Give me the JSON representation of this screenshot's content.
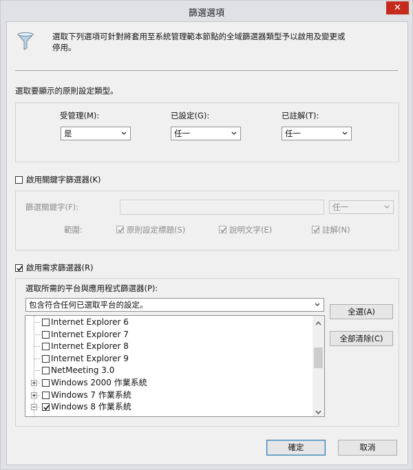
{
  "window": {
    "title": "篩選選項",
    "close_glyph": "✕"
  },
  "intro": {
    "text_line1": "選取下列選項可針對將套用至系統管理範本節點的全域篩選器類型予以啟用及變更或",
    "text_line2": "停用。"
  },
  "type_section": {
    "label": "選取要顯示的原則設定類型。"
  },
  "managed": {
    "label": "受管理(M):",
    "value": "是"
  },
  "configured": {
    "label": "已設定(G):",
    "value": "任一"
  },
  "commented": {
    "label": "已註解(T):",
    "value": "任一"
  },
  "keyword": {
    "checkbox_label": "啟用關鍵字篩選器(K)",
    "checked": false,
    "filter_label": "篩選關鍵字(F):",
    "input_value": "",
    "match_value": "任一",
    "scope_label": "範圍:",
    "scope_policy_title": "原則設定標題(S)",
    "scope_help_text": "說明文字(E)",
    "scope_comment": "註解(N)"
  },
  "requirements": {
    "checkbox_label": "啟用需求篩選器(R)",
    "checked": true,
    "platforms_label": "選取所需的平台與應用程式篩選器(P):",
    "mode_value": "包含符合任何已選取平台的設定。",
    "items": [
      {
        "label": "Internet Explorer 6",
        "checked": false,
        "expander": "",
        "partial": false
      },
      {
        "label": "Internet Explorer 7",
        "checked": false,
        "expander": "",
        "partial": false
      },
      {
        "label": "Internet Explorer 8",
        "checked": false,
        "expander": "",
        "partial": false
      },
      {
        "label": "Internet Explorer 9",
        "checked": false,
        "expander": "",
        "partial": false
      },
      {
        "label": "NetMeeting 3.0",
        "checked": false,
        "expander": "",
        "partial": false
      },
      {
        "label": "Windows 2000 作業系統",
        "checked": false,
        "expander": "+",
        "partial": false
      },
      {
        "label": "Windows 7 作業系統",
        "checked": false,
        "expander": "+",
        "partial": false
      },
      {
        "label": "Windows 8 作業系統",
        "checked": true,
        "expander": "-",
        "partial": false
      }
    ],
    "select_all": "全選(A)",
    "clear_all": "全部清除(C)"
  },
  "footer": {
    "ok": "確定",
    "cancel": "取消"
  }
}
